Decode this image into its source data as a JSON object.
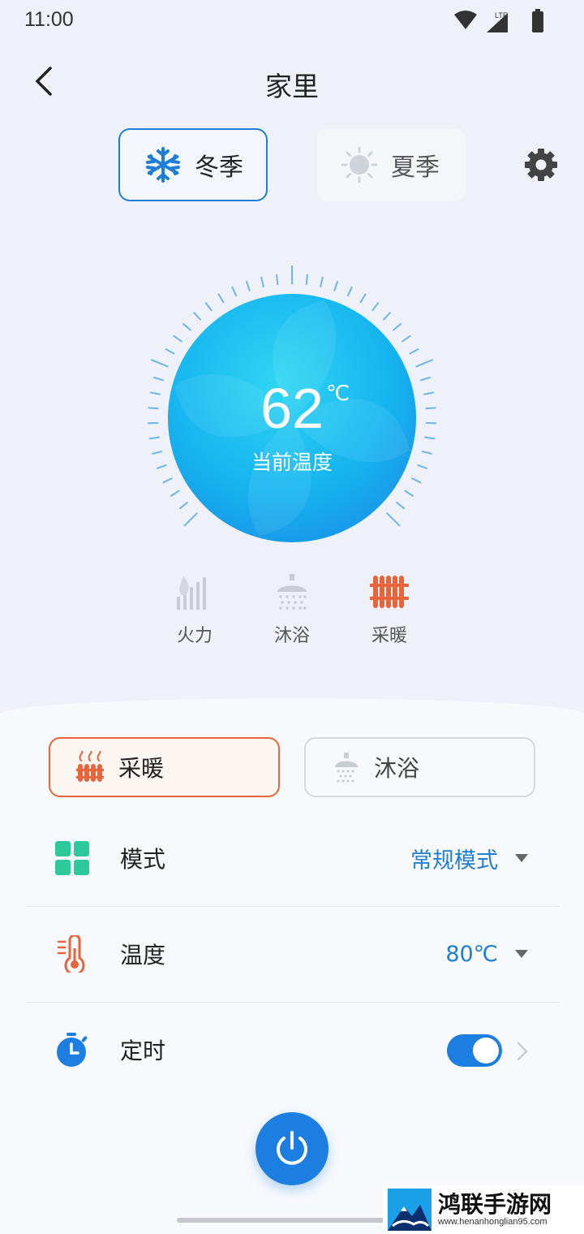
{
  "status_bar": {
    "time": "11:00",
    "network": "LTE",
    "icons": [
      "wifi-icon",
      "signal-icon",
      "battery-icon"
    ]
  },
  "header": {
    "title": "家里",
    "back_icon": "chevron-left-icon"
  },
  "seasons": [
    {
      "label": "冬季",
      "icon": "snowflake-icon",
      "selected": true
    },
    {
      "label": "夏季",
      "icon": "sun-icon",
      "selected": false
    }
  ],
  "settings_icon": "gear-icon",
  "dial": {
    "value": "62",
    "unit": "℃",
    "caption": "当前温度"
  },
  "status_items": [
    {
      "label": "火力",
      "icon": "flame-bars-icon",
      "active": false
    },
    {
      "label": "沐浴",
      "icon": "shower-icon",
      "active": false
    },
    {
      "label": "采暖",
      "icon": "radiator-icon",
      "active": true
    }
  ],
  "tabs": [
    {
      "label": "采暖",
      "icon": "radiator-icon",
      "selected": true
    },
    {
      "label": "沐浴",
      "icon": "shower-icon",
      "selected": false
    }
  ],
  "settings_rows": {
    "mode": {
      "label": "模式",
      "value": "常规模式",
      "icon": "grid-icon"
    },
    "temperature": {
      "label": "温度",
      "value": "80℃",
      "icon": "thermometer-icon"
    },
    "timer": {
      "label": "定时",
      "enabled": true,
      "icon": "timer-icon"
    }
  },
  "power_icon": "power-icon",
  "watermark": {
    "title": "鸿联手游网",
    "url": "www.henanhonglian95.com"
  },
  "colors": {
    "accent": "#1c7ee0",
    "heating": "#e8643a",
    "mode_green": "#2ec99a",
    "background": "#eef1f8"
  }
}
